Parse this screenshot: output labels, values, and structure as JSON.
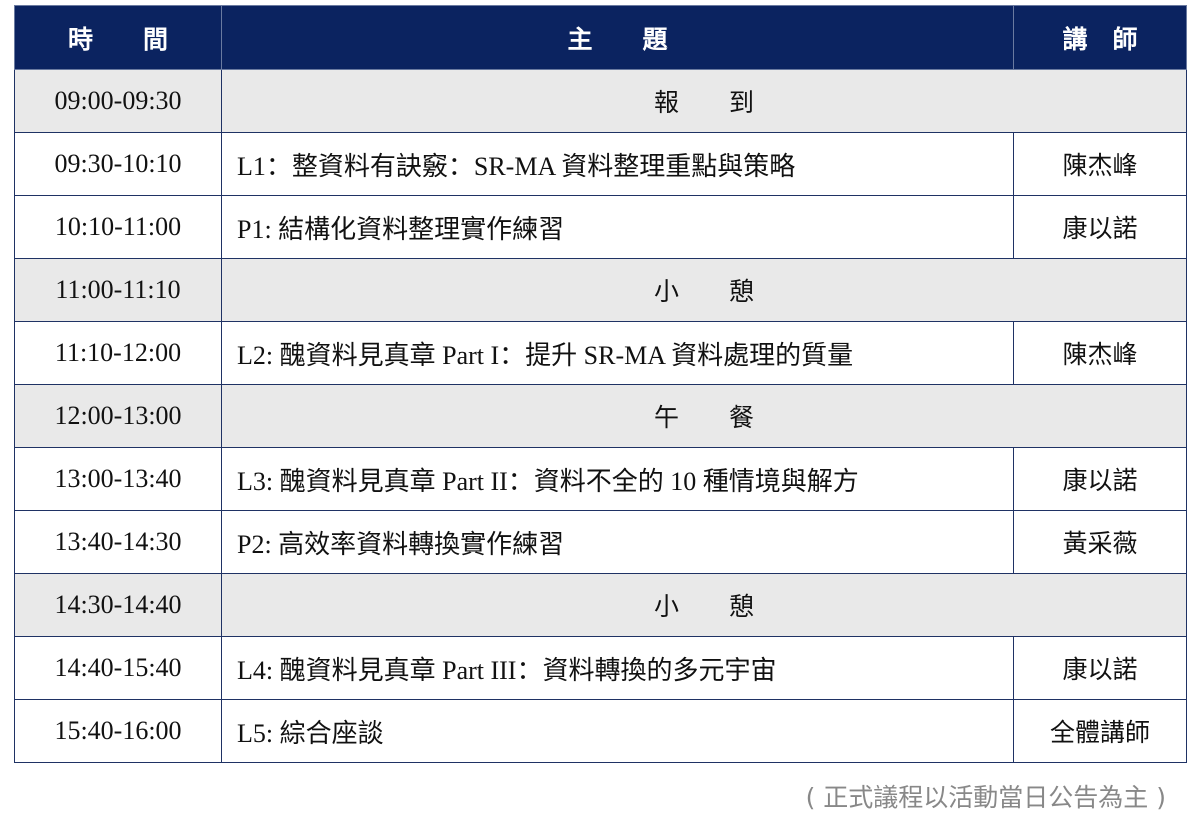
{
  "header": {
    "time": "時　　間",
    "topic": "主　　題",
    "speaker": "講　師"
  },
  "rows": [
    {
      "time": "09:00-09:30",
      "topic": "報　　到",
      "speaker": ""
    },
    {
      "time": "09:30-10:10",
      "topic": "L1：整資料有訣竅：SR-MA 資料整理重點與策略",
      "speaker": "陳杰峰"
    },
    {
      "time": "10:10-11:00",
      "topic": "P1: 結構化資料整理實作練習",
      "speaker": "康以諾"
    },
    {
      "time": "11:00-11:10",
      "topic": "小　　憩",
      "speaker": ""
    },
    {
      "time": "11:10-12:00",
      "topic": "L2: 醜資料見真章 Part I：提升 SR-MA 資料處理的質量",
      "speaker": "陳杰峰"
    },
    {
      "time": "12:00-13:00",
      "topic": "午　　餐",
      "speaker": ""
    },
    {
      "time": "13:00-13:40",
      "topic": "L3: 醜資料見真章 Part II：資料不全的 10 種情境與解方",
      "speaker": "康以諾"
    },
    {
      "time": "13:40-14:30",
      "topic": "P2: 高效率資料轉換實作練習",
      "speaker": "黃采薇"
    },
    {
      "time": "14:30-14:40",
      "topic": "小　　憩",
      "speaker": ""
    },
    {
      "time": "14:40-15:40",
      "topic": "L4: 醜資料見真章 Part III：資料轉換的多元宇宙",
      "speaker": "康以諾"
    },
    {
      "time": "15:40-16:00",
      "topic": "L5: 綜合座談",
      "speaker": "全體講師"
    }
  ],
  "note": "( 正式議程以活動當日公告為主 )"
}
